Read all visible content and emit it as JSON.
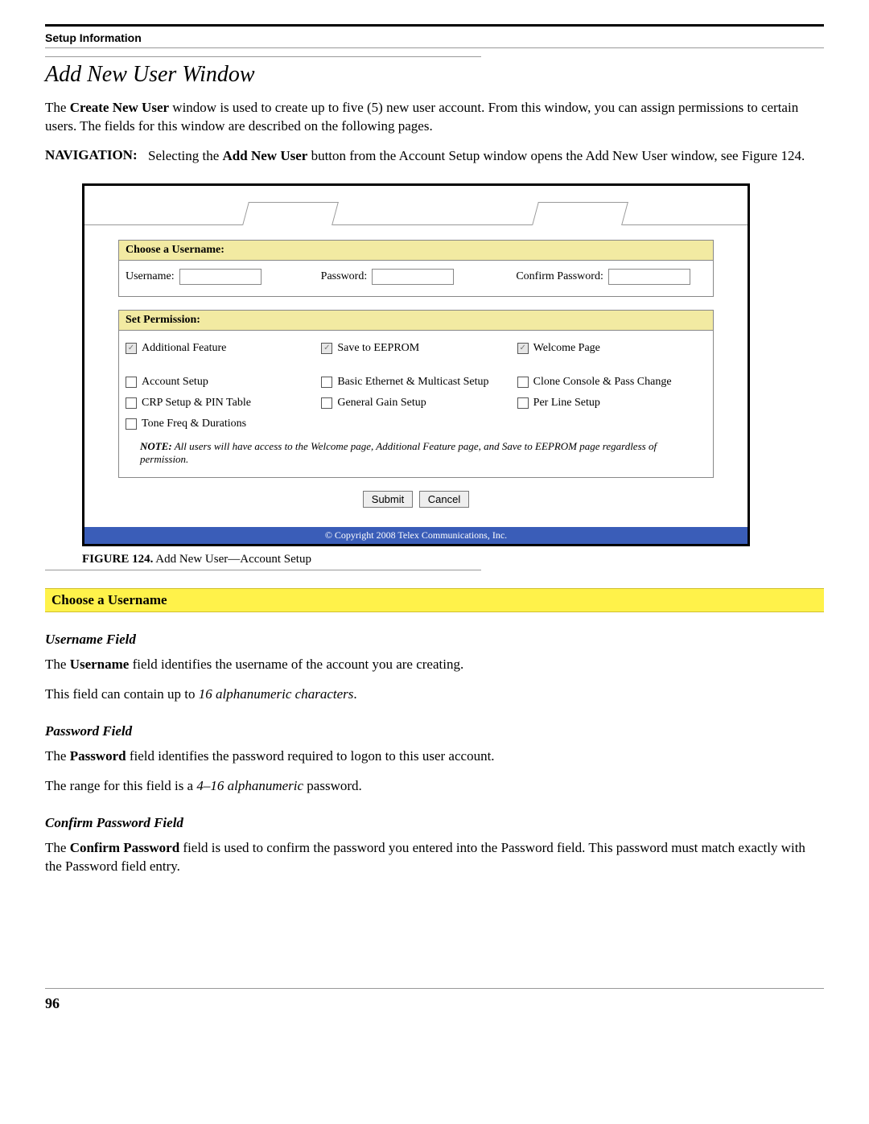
{
  "header": {
    "section": "Setup Information"
  },
  "title": "Add New User Window",
  "intro": {
    "p1_pre": "The ",
    "p1_bold": "Create New User",
    "p1_post": " window is used to create up to five (5) new user account. From this window, you can assign permissions to certain users. The fields for this window are described on the following pages."
  },
  "nav": {
    "label": "NAVIGATION:",
    "text_pre": "Selecting the ",
    "text_bold": "Add New User",
    "text_post": " button from the Account Setup window opens the Add New User window, see Figure 124."
  },
  "figure": {
    "panel1_title": "Choose a Username:",
    "username_label": "Username:",
    "password_label": "Password:",
    "confirm_label": "Confirm Password:",
    "panel2_title": "Set Permission:",
    "perm_locked": {
      "a": "Additional Feature",
      "b": "Save to EEPROM",
      "c": "Welcome Page"
    },
    "perm": {
      "r1c1": "Account Setup",
      "r1c2": "Basic Ethernet & Multicast Setup",
      "r1c3": "Clone Console & Pass Change",
      "r2c1": "CRP Setup & PIN Table",
      "r2c2": "General Gain Setup",
      "r2c3": "Per Line Setup",
      "r3c1": "Tone Freq & Durations"
    },
    "note_label": "NOTE:",
    "note_text": " All users will have access to the Welcome page, Additional Feature page, and Save to EEPROM page regardless of permission.",
    "submit": "Submit",
    "cancel": "Cancel",
    "copyright": "© Copyright 2008 Telex Communications, Inc.",
    "caption_num": "FIGURE 124.",
    "caption_text": " Add New User—Account Setup"
  },
  "band": "Choose a Username",
  "username_field": {
    "heading": "Username Field",
    "p1_pre": "The ",
    "p1_bold": "Username",
    "p1_post": " field identifies the username of the account you are creating.",
    "p2_pre": "This field can contain up to ",
    "p2_ital": "16 alphanumeric characters",
    "p2_post": "."
  },
  "password_field": {
    "heading": "Password Field",
    "p1_pre": "The ",
    "p1_bold": "Password",
    "p1_post": " field identifies the password required to logon to this user account.",
    "p2_pre": "The range for this field is a ",
    "p2_ital": "4–16 alphanumeric",
    "p2_post": " password."
  },
  "confirm_field": {
    "heading": "Confirm Password Field",
    "p1_pre": "The ",
    "p1_bold": "Confirm Password",
    "p1_post": " field is used to confirm the password you entered into the Password field. This password must match exactly with the Password field entry."
  },
  "page_number": "96"
}
